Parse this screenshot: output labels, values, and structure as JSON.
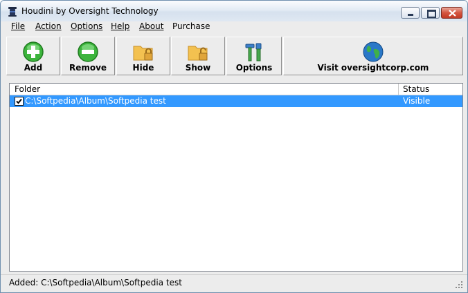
{
  "window": {
    "title": "Houdini by Oversight Technology"
  },
  "menu": [
    {
      "label": "File"
    },
    {
      "label": "Action"
    },
    {
      "label": "Options"
    },
    {
      "label": "Help"
    },
    {
      "label": "About"
    },
    {
      "label": "Purchase"
    }
  ],
  "toolbar": {
    "add_label": "Add",
    "remove_label": "Remove",
    "hide_label": "Hide",
    "show_label": "Show",
    "options_label": "Options",
    "visit_label": "Visit oversightcorp.com"
  },
  "list": {
    "columns": {
      "folder": "Folder",
      "status": "Status"
    },
    "rows": [
      {
        "folder": "C:\\Softpedia\\Album\\Softpedia test",
        "status": "Visible",
        "checked": true
      }
    ]
  },
  "status": {
    "text": "Added: C:\\Softpedia\\Album\\Softpedia test"
  },
  "colors": {
    "selection": "#3399ff",
    "add_green": "#3cb43c",
    "folder_yellow": "#f3c150",
    "globe_blue": "#2a78c8"
  }
}
